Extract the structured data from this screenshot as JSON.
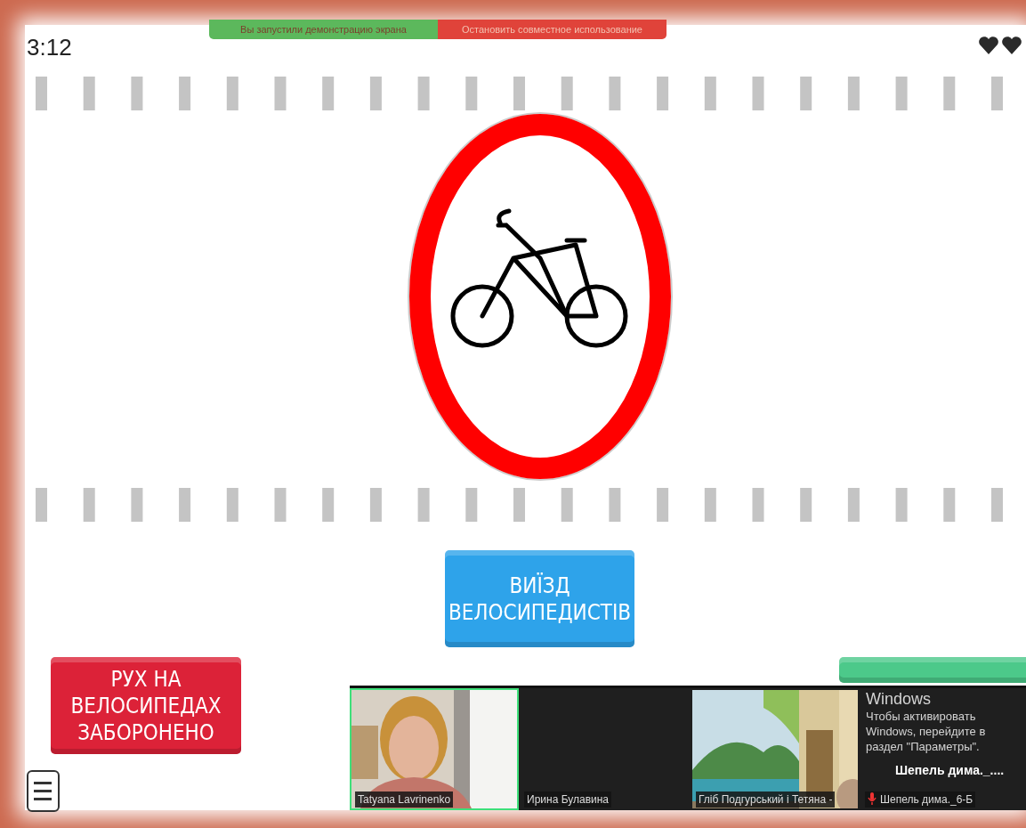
{
  "timer": "3:12",
  "share_banner": {
    "status": "Вы запустили демонстрацию экрана",
    "stop": "Остановить совместное использование"
  },
  "lives": [
    {
      "kind": "heart"
    },
    {
      "kind": "heart"
    }
  ],
  "answers": [
    {
      "label": "ВИЇЗД ВЕЛОСИПЕДИСТІВ",
      "color": "#2ea3ea"
    },
    {
      "label": "РУХ НА ВЕЛОСИПЕДАХ ЗАБОРОНЕНО",
      "color": "#dc2238"
    },
    {
      "color": "#4cc98a"
    }
  ],
  "participants": [
    {
      "name": "Tatyana Lavrinenko",
      "kind": "person",
      "speaking": true
    },
    {
      "name": "Ирина Булавина",
      "kind": "off",
      "speaking": false
    },
    {
      "name": "Гліб Подгурський і Тетяна -",
      "kind": "room",
      "speaking": false
    },
    {
      "name": "Шепель дима._6-Б",
      "display_name": "Шепель дима._....",
      "kind": "off",
      "speaking": false,
      "muted": true
    }
  ],
  "windows_activation": {
    "title": "Windows",
    "text": "Чтобы активировать Windows, перейдите в раздел \"Параметры\"."
  }
}
